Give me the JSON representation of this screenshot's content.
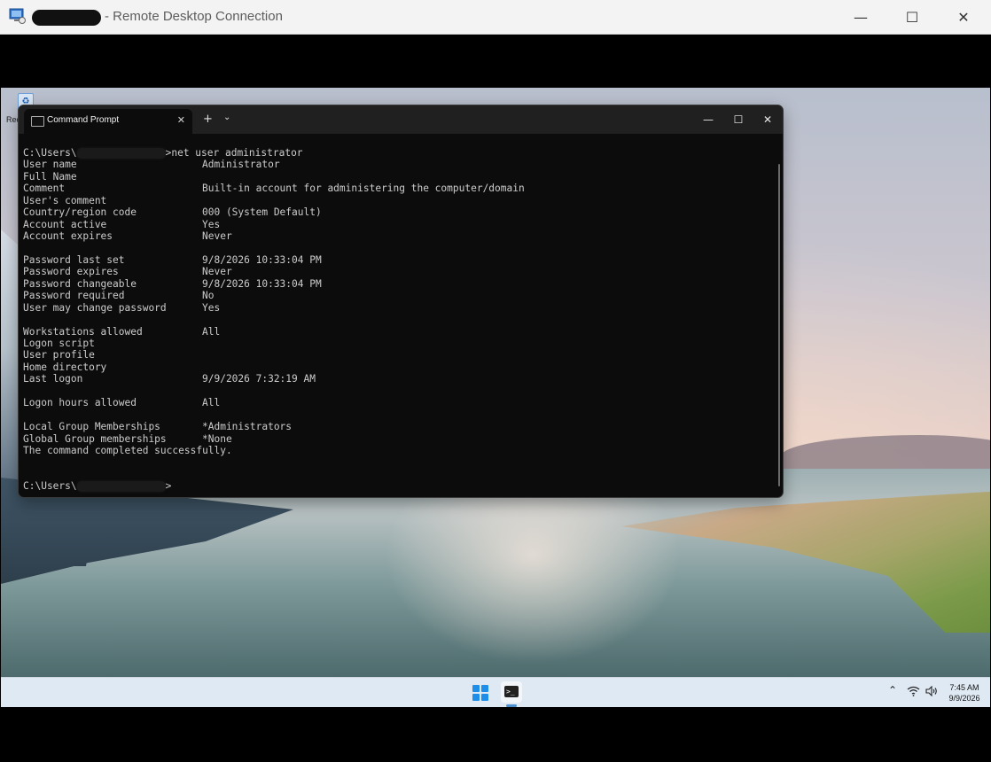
{
  "rdp": {
    "title": "- Remote Desktop Connection",
    "minimize": "—",
    "maximize": "☐",
    "close": "✕"
  },
  "desktop": {
    "icon_label": "Rec"
  },
  "terminal": {
    "tab_label": "Command Prompt",
    "tab_close": "✕",
    "new_tab": "+",
    "dropdown": "⌄",
    "minimize": "—",
    "maximize": "☐",
    "close": "✕",
    "prompt_prefix": "C:\\Users\\",
    "command": ">net user administrator",
    "rows": [
      {
        "label": "User name",
        "value": "Administrator"
      },
      {
        "label": "Full Name",
        "value": ""
      },
      {
        "label": "Comment",
        "value": "Built-in account for administering the computer/domain"
      },
      {
        "label": "User's comment",
        "value": ""
      },
      {
        "label": "Country/region code",
        "value": "000 (System Default)"
      },
      {
        "label": "Account active",
        "value": "Yes"
      },
      {
        "label": "Account expires",
        "value": "Never"
      },
      {
        "label": "",
        "value": ""
      },
      {
        "label": "Password last set",
        "value": "9/8/2026 10:33:04 PM"
      },
      {
        "label": "Password expires",
        "value": "Never"
      },
      {
        "label": "Password changeable",
        "value": "9/8/2026 10:33:04 PM"
      },
      {
        "label": "Password required",
        "value": "No"
      },
      {
        "label": "User may change password",
        "value": "Yes"
      },
      {
        "label": "",
        "value": ""
      },
      {
        "label": "Workstations allowed",
        "value": "All"
      },
      {
        "label": "Logon script",
        "value": ""
      },
      {
        "label": "User profile",
        "value": ""
      },
      {
        "label": "Home directory",
        "value": ""
      },
      {
        "label": "Last logon",
        "value": "9/9/2026 7:32:19 AM"
      },
      {
        "label": "",
        "value": ""
      },
      {
        "label": "Logon hours allowed",
        "value": "All"
      },
      {
        "label": "",
        "value": ""
      },
      {
        "label": "Local Group Memberships",
        "value": "*Administrators"
      },
      {
        "label": "Global Group memberships",
        "value": "*None"
      }
    ],
    "completed": "The command completed successfully.",
    "final_prompt_suffix": ">"
  },
  "taskbar": {
    "tray_chevron": "⌃",
    "wifi_icon": "wifi-icon",
    "volume_icon": "volume-icon",
    "time": "7:45 AM",
    "date": "9/9/2026"
  }
}
